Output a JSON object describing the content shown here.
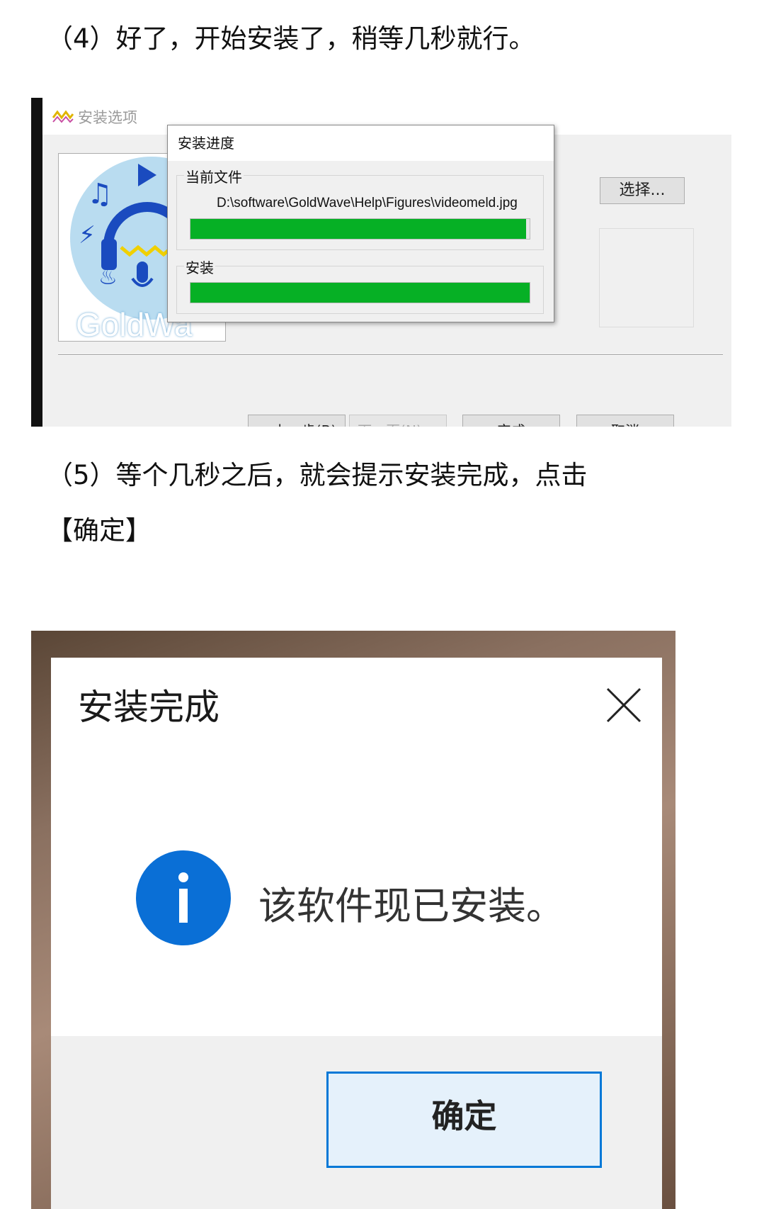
{
  "article": {
    "step4_text": "（4）好了，开始安装了，稍等几秒就行。",
    "step5_line1": "（5）等个几秒之后，就会提示安装完成，点击",
    "step5_line2": "【确定】"
  },
  "install_window": {
    "title": "安装选项",
    "logo_text": "GoldWa",
    "choose_button": "选择...",
    "buttons": {
      "back": "< 上一步(B)",
      "next": "下一页(N) >",
      "finish": "完成",
      "cancel": "取消"
    },
    "progress_dialog": {
      "title": "安装进度",
      "current_file_label": "当前文件",
      "current_file_path": "D:\\software\\GoldWave\\Help\\Figures\\videomeld.jpg",
      "file_progress": 0.99,
      "install_label": "安装",
      "install_progress": 1.0,
      "bar_color": "#06b025"
    }
  },
  "complete_dialog": {
    "title": "安装完成",
    "message": "该软件现已安装。",
    "ok_button": "确定",
    "icon": "info-icon",
    "accent_color": "#0078d7"
  }
}
